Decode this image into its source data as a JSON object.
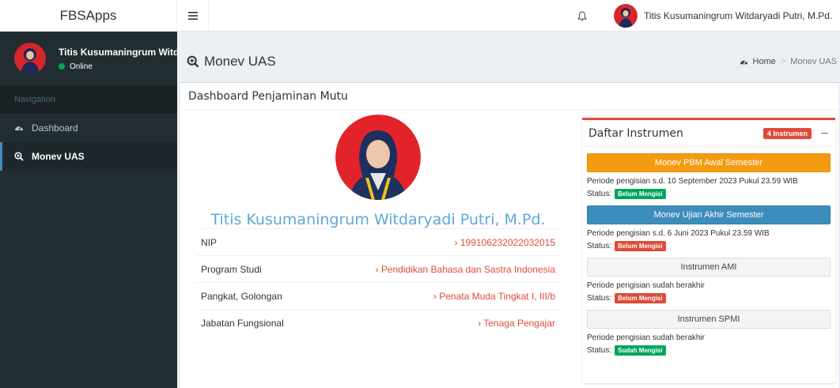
{
  "app": {
    "logo": "FBSApps"
  },
  "topbar": {
    "user_name": "Titis Kusumaningrum Witdaryadi Putri, M.Pd."
  },
  "sidebar": {
    "user_name": "Titis Kusumaningrum Witdaryadi Putri, M.Pd.",
    "user_status": "Online",
    "nav_header": "Navigation",
    "items": [
      {
        "label": "Dashboard",
        "icon": "dashboard-icon"
      },
      {
        "label": "Monev UAS",
        "icon": "search-plus-icon"
      }
    ]
  },
  "page": {
    "title": "Monev UAS",
    "breadcrumb": {
      "home": "Home",
      "current": "Monev UAS"
    }
  },
  "box": {
    "title": "Dashboard Penjaminan Mutu"
  },
  "profile": {
    "name": "Titis Kusumaningrum Witdaryadi Putri, M.Pd.",
    "rows": [
      {
        "label": "NIP",
        "value": "› 199106232022032015"
      },
      {
        "label": "Program Studi",
        "value": "› Pendidikan Bahasa dan Sastra Indonesia"
      },
      {
        "label": "Pangkat, Golongan",
        "value": "› Penata Muda Tingkat I, III/b"
      },
      {
        "label": "Jabatan Fungsional",
        "value": "› Tenaga Pengajar"
      }
    ]
  },
  "instruments": {
    "title": "Daftar Instrumen",
    "badge": "4 Instrumen",
    "status_label": "Status:",
    "items": [
      {
        "button": "Monev PBM Awal Semester",
        "period": "Periode pengisian s.d. 10 September 2023 Pukul 23.59 WIB",
        "status": "Belum Mengisi"
      },
      {
        "button": "Monev Ujian Akhir Semester",
        "period": "Periode pengisian s.d. 6 Juni 2023 Pukul 23.59 WIB",
        "status": "Belum Mengisi"
      },
      {
        "button": "Instrumen AMI",
        "period": "Periode pengisian sudah berakhir",
        "status": "Belum Mengisi"
      },
      {
        "button": "Instrumen SPMI",
        "period": "Periode pengisian sudah berakhir",
        "status": "Sudah Mengisi"
      }
    ]
  },
  "colors": {
    "sidebar_bg": "#222d32",
    "orange": "#f39c12",
    "blue": "#3c8dbc",
    "red": "#dd4b39",
    "green": "#00a65a",
    "name_blue": "#5ea9d6"
  }
}
